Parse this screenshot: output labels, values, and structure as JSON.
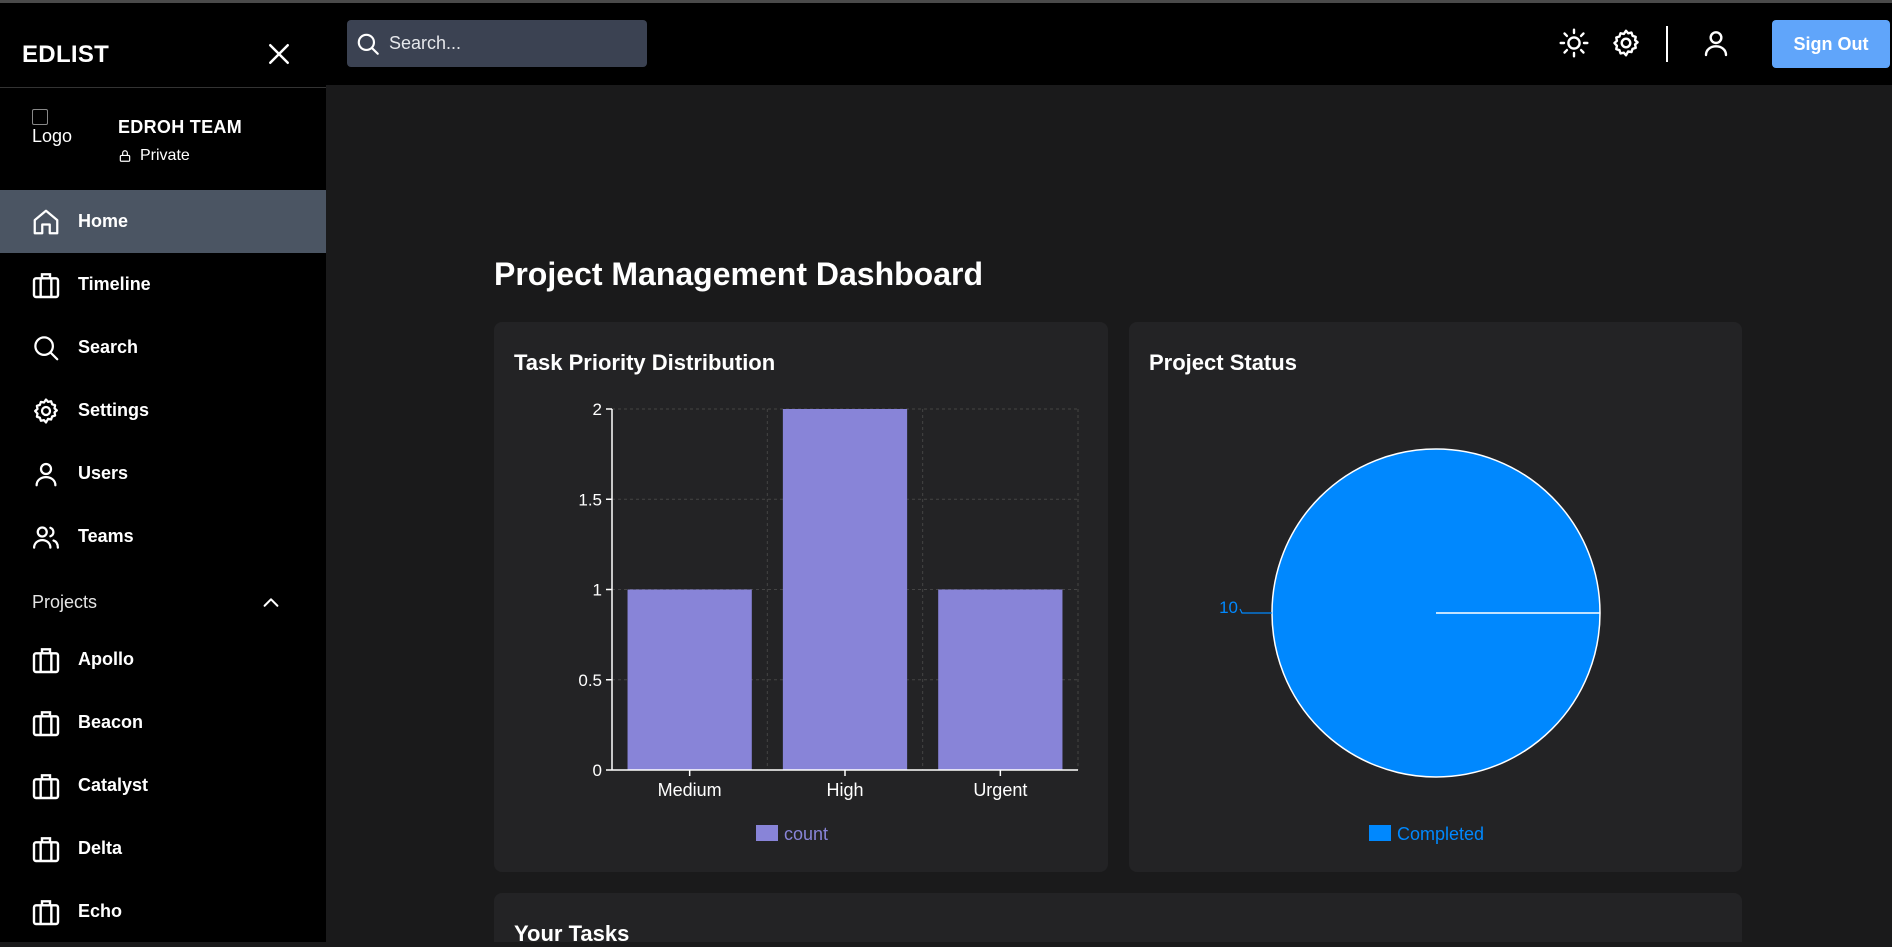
{
  "app": {
    "brand": "EDLIST"
  },
  "team": {
    "logo_alt": "Logo",
    "name": "EDROH TEAM",
    "visibility": "Private"
  },
  "nav": [
    {
      "label": "Home",
      "icon": "home-icon",
      "active": true
    },
    {
      "label": "Timeline",
      "icon": "briefcase-icon",
      "active": false
    },
    {
      "label": "Search",
      "icon": "search-icon",
      "active": false
    },
    {
      "label": "Settings",
      "icon": "gear-icon",
      "active": false
    },
    {
      "label": "Users",
      "icon": "user-icon",
      "active": false
    },
    {
      "label": "Teams",
      "icon": "users-icon",
      "active": false
    }
  ],
  "projects_section": {
    "label": "Projects",
    "expanded": true
  },
  "projects": [
    {
      "label": "Apollo",
      "icon": "briefcase-icon"
    },
    {
      "label": "Beacon",
      "icon": "briefcase-icon"
    },
    {
      "label": "Catalyst",
      "icon": "briefcase-icon"
    },
    {
      "label": "Delta",
      "icon": "briefcase-icon"
    },
    {
      "label": "Echo",
      "icon": "briefcase-icon"
    }
  ],
  "topbar": {
    "search_placeholder": "Search...",
    "icons": [
      "sun-icon",
      "gear-icon",
      "user-icon"
    ],
    "signout_label": "Sign Out"
  },
  "colors": {
    "accent": "#60a5fa",
    "active_nav": "#4b5563",
    "bar": "#8884d8",
    "pie": "#0088fe"
  },
  "main": {
    "title": "Project Management Dashboard",
    "priority_card_title": "Task Priority Distribution",
    "status_card_title": "Project Status",
    "tasks_card_title": "Your Tasks"
  },
  "chart_data": [
    {
      "type": "bar",
      "title": "Task Priority Distribution",
      "categories": [
        "Medium",
        "High",
        "Urgent"
      ],
      "series": [
        {
          "name": "count",
          "values": [
            1,
            2,
            1
          ]
        }
      ],
      "y_ticks": [
        "0",
        "0.5",
        "1",
        "1.5",
        "2"
      ],
      "ylim": [
        0,
        2
      ],
      "grid": true,
      "legend": "bottom"
    },
    {
      "type": "pie",
      "title": "Project Status",
      "slices": [
        {
          "name": "Completed",
          "value": 10
        }
      ],
      "data_labels": [
        "10"
      ],
      "legend": "bottom"
    }
  ]
}
